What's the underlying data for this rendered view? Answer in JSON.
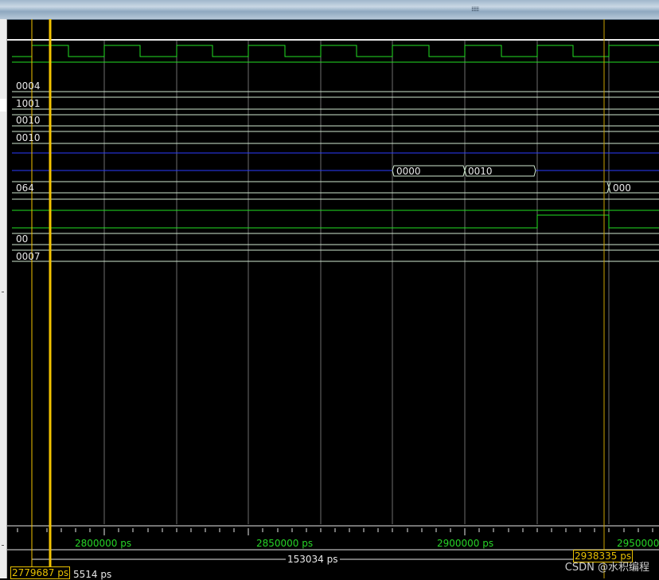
{
  "window": {
    "grip_glyph": "⁞⁞⁞⁞⁞⁞"
  },
  "signals": [
    {
      "value": "0004"
    },
    {
      "value": "1001"
    },
    {
      "value": "0010"
    },
    {
      "value": "0010"
    },
    {
      "value": "064"
    },
    {
      "value": "00"
    },
    {
      "value": "0007"
    }
  ],
  "bus_segments": [
    {
      "value": "0000"
    },
    {
      "value": "0010"
    },
    {
      "value": "000"
    }
  ],
  "timeline": {
    "ticks": [
      "2800000 ps",
      "2850000 ps",
      "2900000 ps",
      "2950000"
    ]
  },
  "cursors": {
    "cursor1_time": "2779687 ps",
    "cursor2_time": "2938335 ps",
    "delta": "153034 ps",
    "offset": "5514 ps"
  },
  "colors": {
    "wave": "#22e022",
    "bus": "#cfe8cf",
    "cursor": "#f4c400",
    "grid": "#6e6e6e",
    "blue_line": "#2b3dff"
  },
  "watermark": "CSDN @水积编程"
}
